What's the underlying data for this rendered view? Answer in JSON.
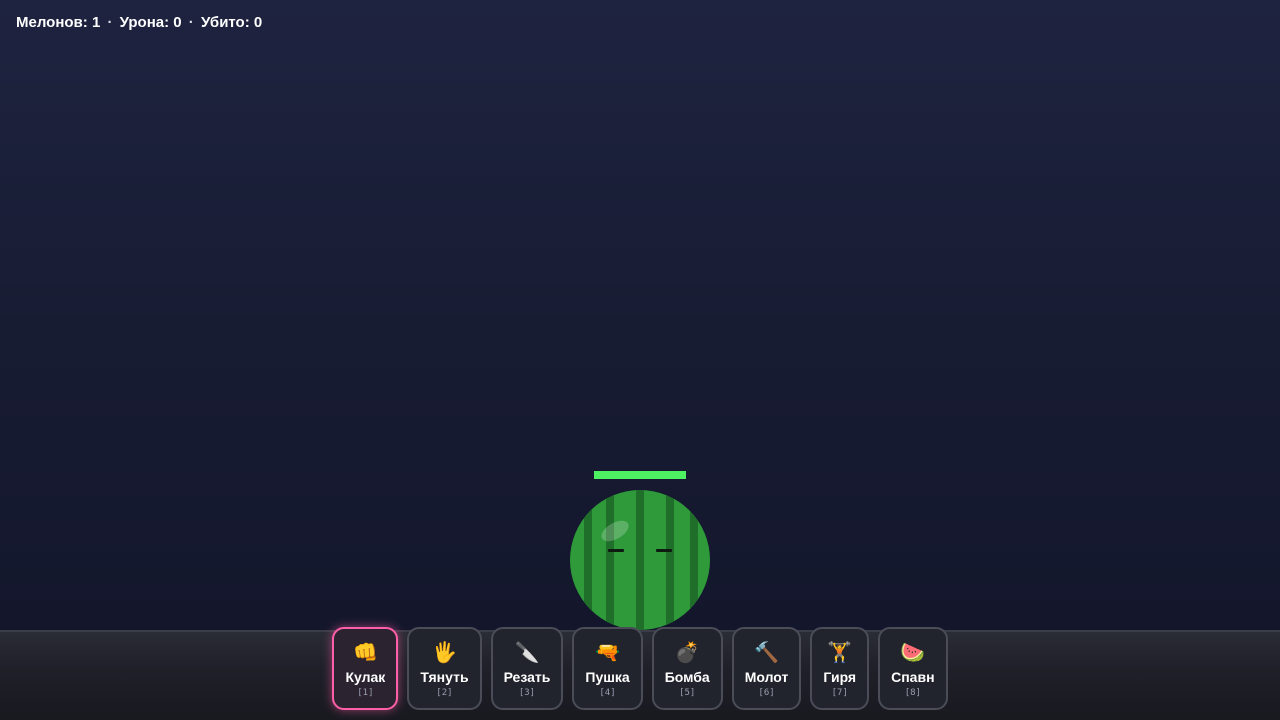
{
  "hud": {
    "melons_label": "Мелонов: 1",
    "damage_label": "Урона: 0",
    "killed_label": "Убито: 0",
    "separator": "·"
  },
  "melon": {
    "health_fraction": 1.0,
    "health_color": "#4cf060",
    "body_color": "#2e9a3a",
    "stripe_color": "#1f6f2a"
  },
  "colors": {
    "accent_active": "#ff5fa8",
    "tool_border": "#4a4c58"
  },
  "tools": [
    {
      "icon": "fist-icon",
      "glyph": "👊",
      "label": "Кулак",
      "key": "[1]",
      "active": true
    },
    {
      "icon": "hand-icon",
      "glyph": "🖐",
      "label": "Тянуть",
      "key": "[2]",
      "active": false
    },
    {
      "icon": "knife-icon",
      "glyph": "🔪",
      "label": "Резать",
      "key": "[3]",
      "active": false
    },
    {
      "icon": "water-gun-icon",
      "glyph": "🔫",
      "label": "Пушка",
      "key": "[4]",
      "active": false
    },
    {
      "icon": "bomb-icon",
      "glyph": "💣",
      "label": "Бомба",
      "key": "[5]",
      "active": false
    },
    {
      "icon": "hammer-icon",
      "glyph": "🔨",
      "label": "Молот",
      "key": "[6]",
      "active": false
    },
    {
      "icon": "weight-icon",
      "glyph": "🏋",
      "label": "Гиря",
      "key": "[7]",
      "active": false
    },
    {
      "icon": "watermelon-icon",
      "glyph": "🍉",
      "label": "Спавн",
      "key": "[8]",
      "active": false
    }
  ]
}
